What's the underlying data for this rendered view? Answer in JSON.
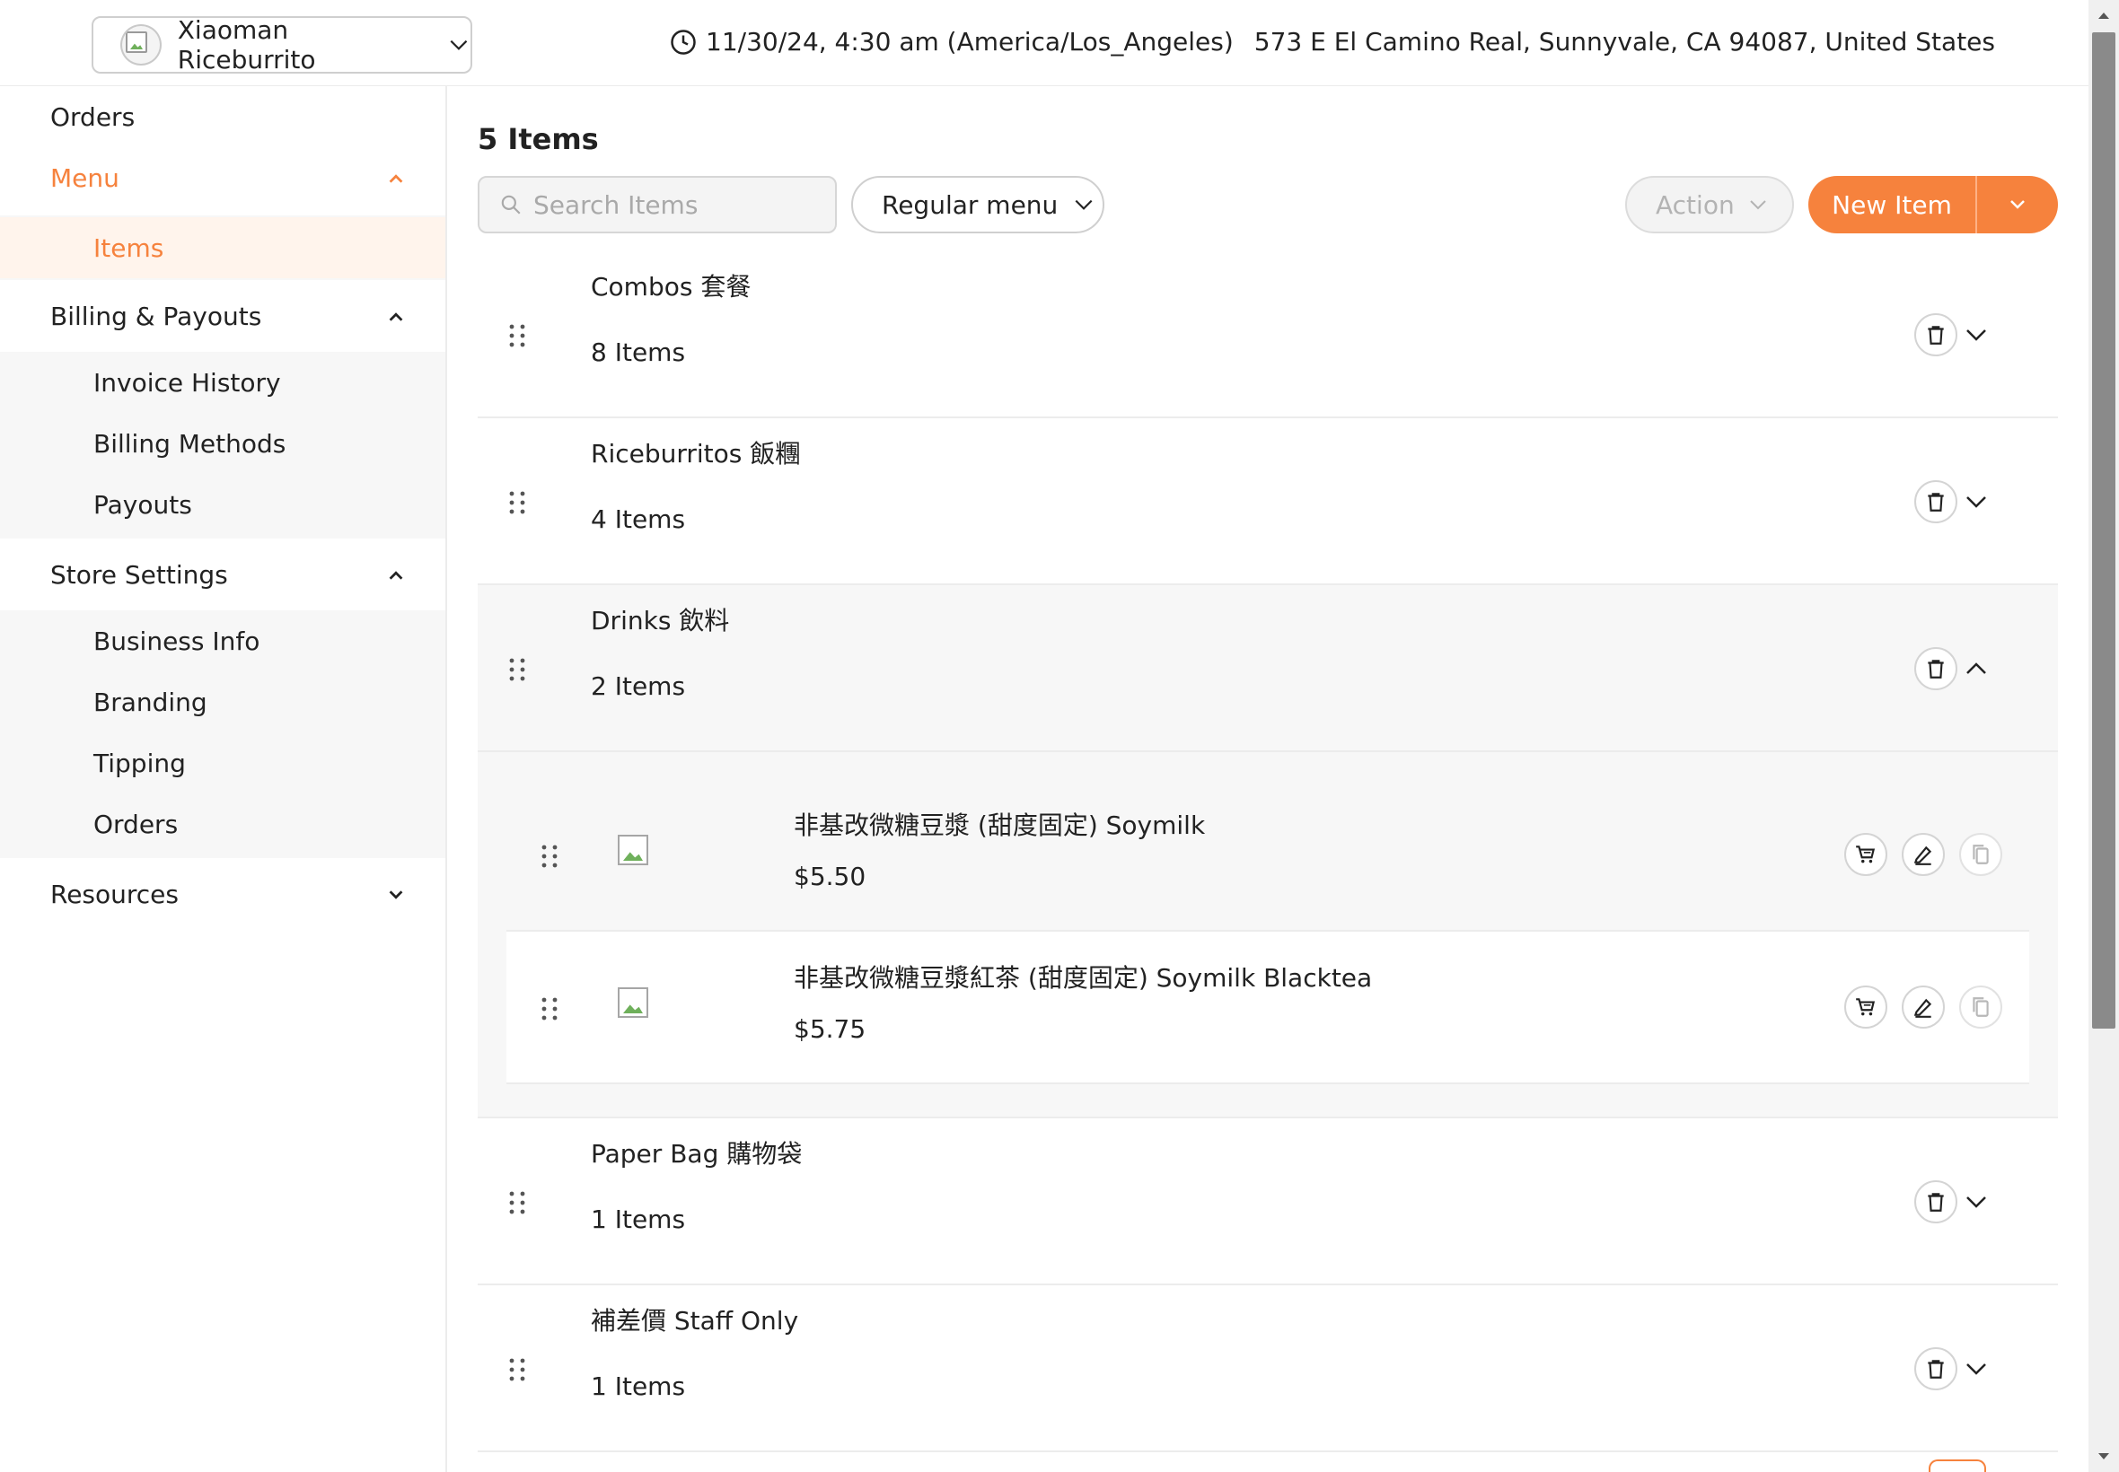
{
  "header": {
    "store_name": "Xiaoman Riceburrito",
    "datetime": "11/30/24, 4:30 am (America/Los_Angeles)",
    "address": "573 E El Camino Real, Sunnyvale, CA 94087, United States"
  },
  "sidebar": {
    "orders": "Orders",
    "menu": "Menu",
    "items": "Items",
    "billing": "Billing & Payouts",
    "invoice_history": "Invoice History",
    "billing_methods": "Billing Methods",
    "payouts": "Payouts",
    "store_settings": "Store Settings",
    "business_info": "Business Info",
    "branding": "Branding",
    "tipping": "Tipping",
    "store_orders": "Orders",
    "resources": "Resources"
  },
  "main": {
    "title": "5 Items",
    "search_placeholder": "Search Items",
    "menu_select": "Regular menu",
    "action_label": "Action",
    "new_item_label": "New Item"
  },
  "categories": [
    {
      "name": "Combos 套餐",
      "count": "8 Items"
    },
    {
      "name": "Riceburritos 飯糰",
      "count": "4 Items"
    },
    {
      "name": "Drinks 飲料",
      "count": "2 Items"
    },
    {
      "name": "Paper Bag 購物袋",
      "count": "1 Items"
    },
    {
      "name": "補差價 Staff Only",
      "count": "1 Items"
    }
  ],
  "drink_items": [
    {
      "name": "非基改微糖豆漿 (甜度固定) Soymilk",
      "price": "$5.50"
    },
    {
      "name": "非基改微糖豆漿紅茶 (甜度固定) Soymilk Blacktea",
      "price": "$5.75"
    }
  ],
  "colors": {
    "accent": "#f6823d",
    "accent_soft": "#fff4ec",
    "panel_gray": "#f7f7f7",
    "border": "#ececec"
  }
}
